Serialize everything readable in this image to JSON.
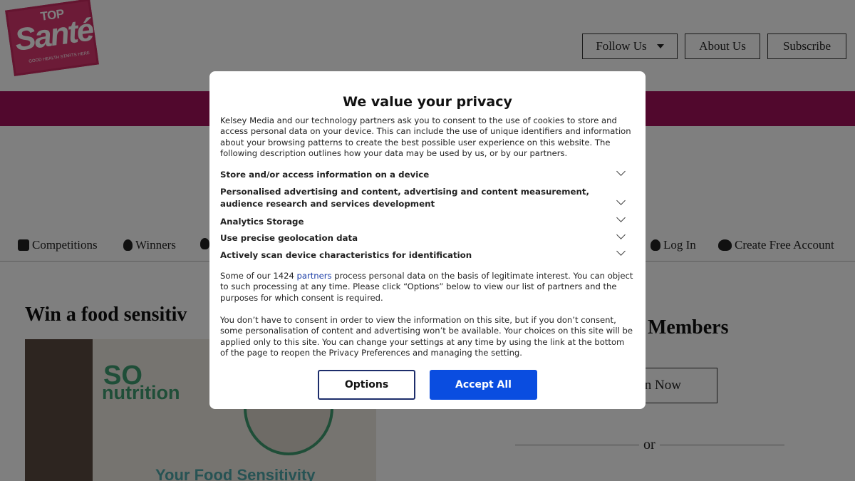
{
  "brand": {
    "logo_top": "TOP",
    "logo_main": "Santé",
    "logo_tagline": "GOOD HEALTH STARTS HERE"
  },
  "header_buttons": {
    "follow": "Follow Us",
    "about": "About Us",
    "subscribe": "Subscribe"
  },
  "nav": {
    "competitions": "Competitions",
    "winners": "Winners",
    "login": "Log In",
    "create_account": "Create Free Account"
  },
  "article": {
    "title": "Win a food sensitiv",
    "hero_so": "SO",
    "hero_nutrition": "nutrition",
    "hero_bottom": "Your Food Sensitivity"
  },
  "sidebar": {
    "members_title": "Members",
    "join_label": "n Now",
    "or_text": "or"
  },
  "consent": {
    "title": "We value your privacy",
    "intro": "Kelsey Media and our technology partners ask you to consent to the use of cookies to store and access personal data on your device. This can include the use of unique identifiers and information about your browsing patterns to create the best possible user experience on this website. The following description outlines how your data may be used by us, or by our partners.",
    "purposes": [
      "Store and/or access information on a device",
      "Personalised advertising and content, advertising and content measurement, audience research and services development",
      "Analytics Storage",
      "Use precise geolocation data",
      "Actively scan device characteristics for identification"
    ],
    "legit_before": "Some of our 1424 ",
    "legit_link": "partners",
    "legit_after": " process personal data on the basis of legitimate interest. You can object to such processing at any time. Please click “Options” below to view our list of partners and the purposes for which consent is required.",
    "noconsent": "You don’t have to consent in order to view the information on this site, but if you don’t consent, some personalisation of content and advertising won’t be available. Your choices on this site will be applied only to this site. You can change your settings at any time by using the link at the bottom of the page to reopen the Privacy Preferences and managing the setting.",
    "options_label": "Options",
    "accept_label": "Accept All"
  },
  "colors": {
    "band": "#a3105a",
    "accept": "#0a4de0",
    "link": "#1a3ca6"
  }
}
